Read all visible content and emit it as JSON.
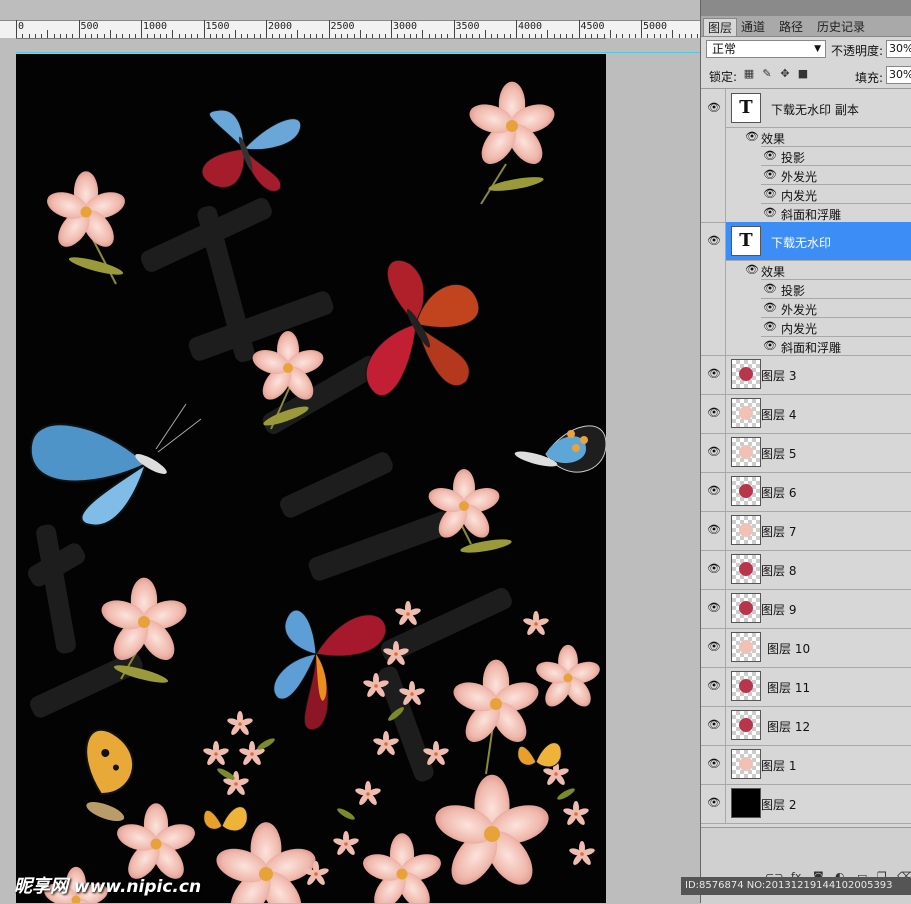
{
  "ruler": {
    "labels": [
      "0",
      "500",
      "1000",
      "1500",
      "2000",
      "2500",
      "3000",
      "3500",
      "4000",
      "4500",
      "5000"
    ]
  },
  "panel": {
    "tabs": [
      "图层",
      "通道",
      "路径",
      "历史记录"
    ],
    "blend_mode": "正常",
    "opacity_label": "不透明度:",
    "opacity_value": "30%",
    "lock_label": "锁定:",
    "fill_label": "填充:",
    "fill_value": "30%",
    "text_layers": [
      {
        "name": "下载无水印 副本",
        "effects_label": "效果",
        "effects": [
          "投影",
          "外发光",
          "内发光",
          "斜面和浮雕"
        ]
      },
      {
        "name": "下载无水印",
        "effects_label": "效果",
        "effects": [
          "投影",
          "外发光",
          "内发光",
          "斜面和浮雕"
        ],
        "selected": true
      }
    ],
    "image_layers": [
      {
        "name": "图层 3",
        "thumb": "butterfly"
      },
      {
        "name": "图层 4",
        "thumb": "flower"
      },
      {
        "name": "图层 5",
        "thumb": "flower"
      },
      {
        "name": "图层 6",
        "thumb": "butterfly"
      },
      {
        "name": "图层 7",
        "thumb": "flower"
      },
      {
        "name": "图层 8",
        "thumb": "butterfly"
      },
      {
        "name": "图层 9",
        "thumb": "butterfly"
      },
      {
        "name": "图层 10",
        "thumb": "flower"
      },
      {
        "name": "图层 11",
        "thumb": "butterfly"
      },
      {
        "name": "图层 12",
        "thumb": "butterfly"
      },
      {
        "name": "图层 1",
        "thumb": "flower"
      },
      {
        "name": "图层 2",
        "thumb": "black"
      }
    ]
  },
  "footer": {
    "watermark_logo": "昵享网",
    "watermark_url": "www.nipic.cn",
    "id_text": "ID:8576874 NO:20131219144102005393"
  },
  "colors": {
    "selected": "#3c8df5",
    "canvas": "#030303",
    "guide": "#40c8e8"
  }
}
